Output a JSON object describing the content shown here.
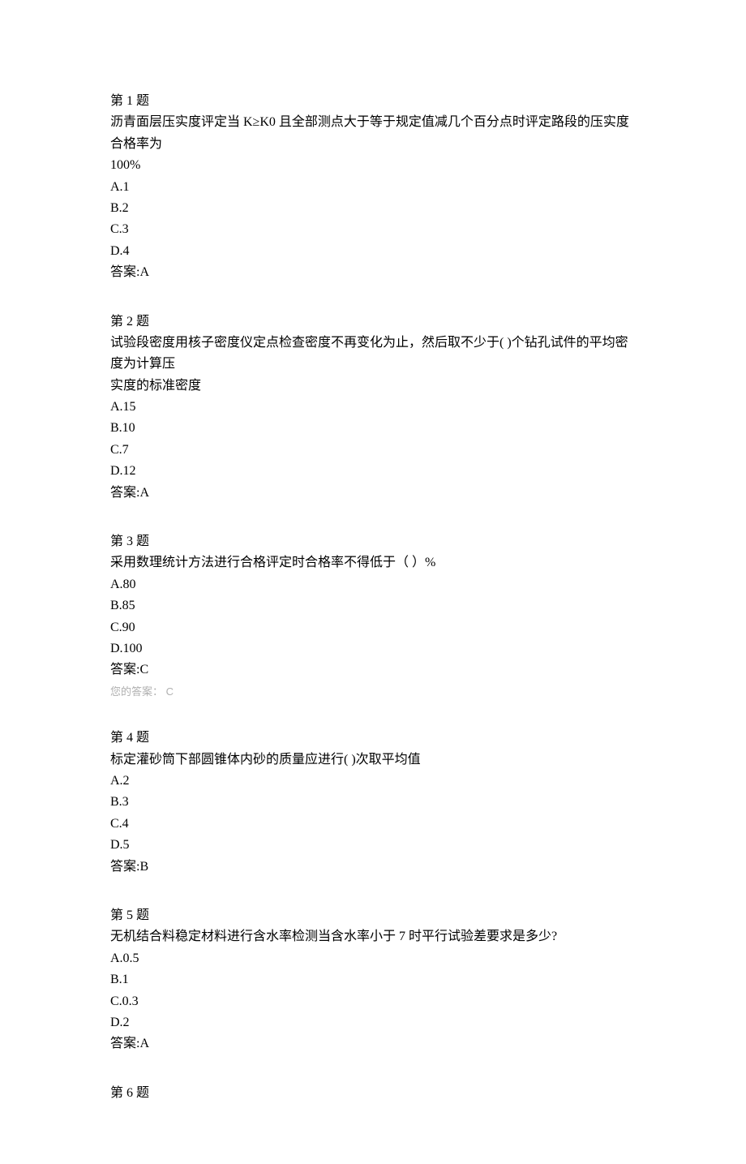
{
  "questions": [
    {
      "header": "第 1 题",
      "stem_lines": [
        "沥青面层压实度评定当 K≥K0 且全部测点大于等于规定值减几个百分点时评定路段的压实度合格率为",
        "100%"
      ],
      "options": [
        "A.1",
        "B.2",
        "C.3",
        "D.4"
      ],
      "answer": "答案:A",
      "user_answer": null
    },
    {
      "header": "第 2 题",
      "stem_lines": [
        "试验段密度用核子密度仪定点检查密度不再变化为止，然后取不少于( )个钻孔试件的平均密度为计算压",
        "实度的标准密度"
      ],
      "options": [
        "A.15",
        "B.10",
        "C.7",
        "D.12"
      ],
      "answer": "答案:A",
      "user_answer": null
    },
    {
      "header": "第 3 题",
      "stem_lines": [
        "采用数理统计方法进行合格评定时合格率不得低于（ ）%"
      ],
      "options": [
        "A.80",
        "B.85",
        "C.90",
        "D.100"
      ],
      "answer": "答案:C",
      "user_answer": "您的答案： C"
    },
    {
      "header": "第 4 题",
      "stem_lines": [
        "标定灌砂筒下部圆锥体内砂的质量应进行( )次取平均值"
      ],
      "options": [
        "A.2",
        "B.3",
        "C.4",
        "D.5"
      ],
      "answer": "答案:B",
      "user_answer": null
    },
    {
      "header": "第 5 题",
      "stem_lines": [
        "无机结合料稳定材料进行含水率检测当含水率小于 7 时平行试验差要求是多少?"
      ],
      "options": [
        "A.0.5",
        "B.1",
        "C.0.3",
        "D.2"
      ],
      "answer": "答案:A",
      "user_answer": null
    },
    {
      "header": "第 6 题",
      "stem_lines": [],
      "options": [],
      "answer": null,
      "user_answer": null
    }
  ]
}
